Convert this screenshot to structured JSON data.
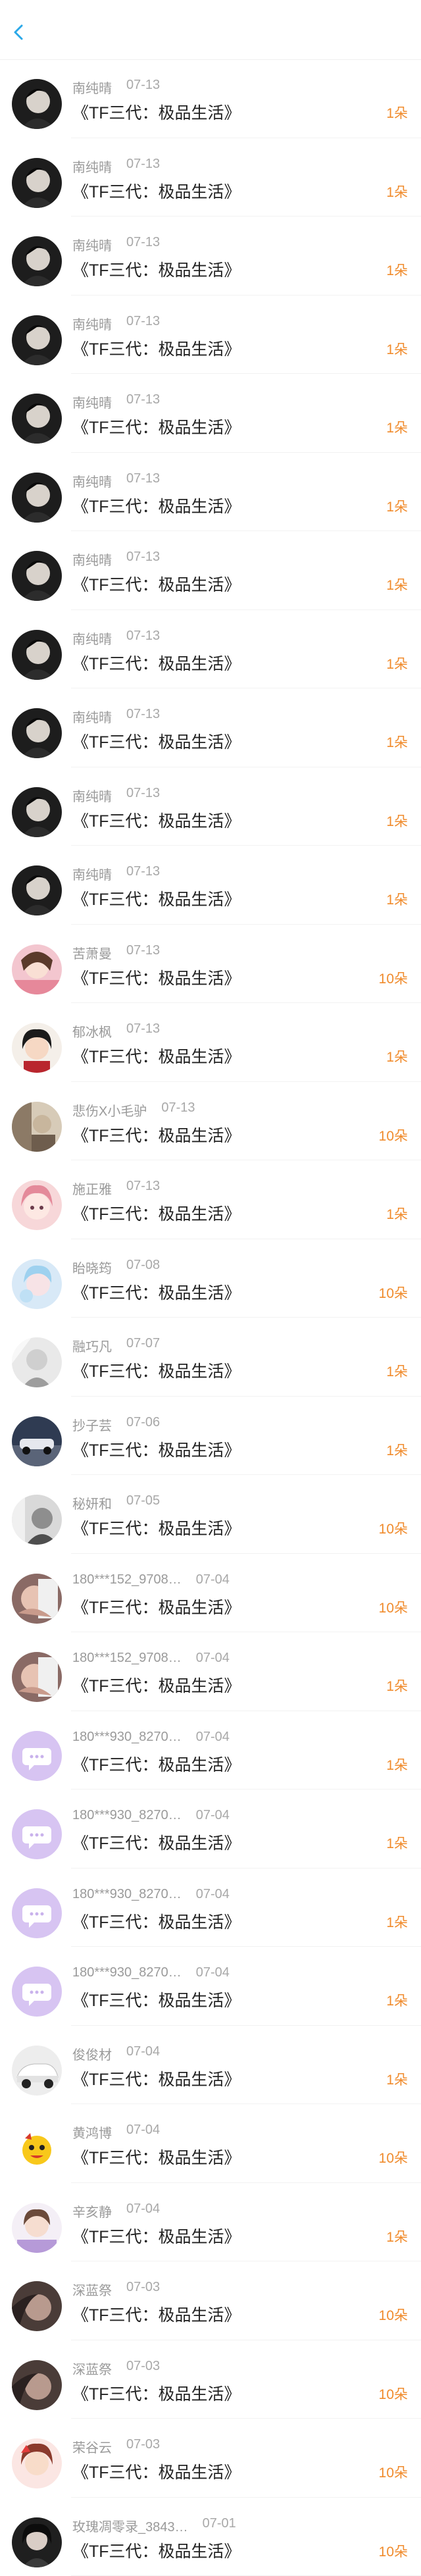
{
  "nav": {
    "back_icon": "chevron-left-icon",
    "accent": "#2aa8e8"
  },
  "list": {
    "amount_color": "#f08b2c",
    "items": [
      {
        "name": "南纯晴",
        "date": "07-13",
        "title": "《TF三代：极品生活》",
        "amount": "1朵",
        "avatar": "dark"
      },
      {
        "name": "南纯晴",
        "date": "07-13",
        "title": "《TF三代：极品生活》",
        "amount": "1朵",
        "avatar": "dark"
      },
      {
        "name": "南纯晴",
        "date": "07-13",
        "title": "《TF三代：极品生活》",
        "amount": "1朵",
        "avatar": "dark"
      },
      {
        "name": "南纯晴",
        "date": "07-13",
        "title": "《TF三代：极品生活》",
        "amount": "1朵",
        "avatar": "dark"
      },
      {
        "name": "南纯晴",
        "date": "07-13",
        "title": "《TF三代：极品生活》",
        "amount": "1朵",
        "avatar": "dark"
      },
      {
        "name": "南纯晴",
        "date": "07-13",
        "title": "《TF三代：极品生活》",
        "amount": "1朵",
        "avatar": "dark"
      },
      {
        "name": "南纯晴",
        "date": "07-13",
        "title": "《TF三代：极品生活》",
        "amount": "1朵",
        "avatar": "dark"
      },
      {
        "name": "南纯晴",
        "date": "07-13",
        "title": "《TF三代：极品生活》",
        "amount": "1朵",
        "avatar": "dark"
      },
      {
        "name": "南纯晴",
        "date": "07-13",
        "title": "《TF三代：极品生活》",
        "amount": "1朵",
        "avatar": "dark"
      },
      {
        "name": "南纯晴",
        "date": "07-13",
        "title": "《TF三代：极品生活》",
        "amount": "1朵",
        "avatar": "dark"
      },
      {
        "name": "南纯晴",
        "date": "07-13",
        "title": "《TF三代：极品生活》",
        "amount": "1朵",
        "avatar": "dark"
      },
      {
        "name": "苦萧曼",
        "date": "07-13",
        "title": "《TF三代：极品生活》",
        "amount": "10朵",
        "avatar": "pink"
      },
      {
        "name": "郁冰枫",
        "date": "07-13",
        "title": "《TF三代：极品生活》",
        "amount": "1朵",
        "avatar": "girl"
      },
      {
        "name": "悲伤X小毛驴",
        "date": "07-13",
        "title": "《TF三代：极品生活》",
        "amount": "10朵",
        "avatar": "sepia"
      },
      {
        "name": "施正雅",
        "date": "07-13",
        "title": "《TF三代：极品生活》",
        "amount": "1朵",
        "avatar": "anime"
      },
      {
        "name": "眙晓筠",
        "date": "07-08",
        "title": "《TF三代：极品生活》",
        "amount": "10朵",
        "avatar": "blue"
      },
      {
        "name": "融巧凡",
        "date": "07-07",
        "title": "《TF三代：极品生活》",
        "amount": "1朵",
        "avatar": "grey"
      },
      {
        "name": "抄子芸",
        "date": "07-06",
        "title": "《TF三代：极品生活》",
        "amount": "1朵",
        "avatar": "car"
      },
      {
        "name": "秘妍和",
        "date": "07-05",
        "title": "《TF三代：极品生活》",
        "amount": "10朵",
        "avatar": "mono"
      },
      {
        "name": "180***152_9708…",
        "date": "07-04",
        "title": "《TF三代：极品生活》",
        "amount": "10朵",
        "avatar": "hands"
      },
      {
        "name": "180***152_9708…",
        "date": "07-04",
        "title": "《TF三代：极品生活》",
        "amount": "1朵",
        "avatar": "hands"
      },
      {
        "name": "180***930_8270…",
        "date": "07-04",
        "title": "《TF三代：极品生活》",
        "amount": "1朵",
        "avatar": "chat"
      },
      {
        "name": "180***930_8270…",
        "date": "07-04",
        "title": "《TF三代：极品生活》",
        "amount": "1朵",
        "avatar": "chat"
      },
      {
        "name": "180***930_8270…",
        "date": "07-04",
        "title": "《TF三代：极品生活》",
        "amount": "1朵",
        "avatar": "chat"
      },
      {
        "name": "180***930_8270…",
        "date": "07-04",
        "title": "《TF三代：极品生活》",
        "amount": "1朵",
        "avatar": "chat"
      },
      {
        "name": "俊俊材",
        "date": "07-04",
        "title": "《TF三代：极品生活》",
        "amount": "1朵",
        "avatar": "whitecar"
      },
      {
        "name": "黄鸿博",
        "date": "07-04",
        "title": "《TF三代：极品生活》",
        "amount": "10朵",
        "avatar": "cartoon"
      },
      {
        "name": "辛亥静",
        "date": "07-04",
        "title": "《TF三代：极品生活》",
        "amount": "1朵",
        "avatar": "doll"
      },
      {
        "name": "深蓝祭",
        "date": "07-03",
        "title": "《TF三代：极品生活》",
        "amount": "10朵",
        "avatar": "brown"
      },
      {
        "name": "深蓝祭",
        "date": "07-03",
        "title": "《TF三代：极品生活》",
        "amount": "10朵",
        "avatar": "brown"
      },
      {
        "name": "荣谷云",
        "date": "07-03",
        "title": "《TF三代：极品生活》",
        "amount": "10朵",
        "avatar": "redgirl"
      },
      {
        "name": "玫瑰凋零录_3843…",
        "date": "07-01",
        "title": "《TF三代：极品生活》",
        "amount": "10朵",
        "avatar": "darkgirl"
      }
    ]
  }
}
